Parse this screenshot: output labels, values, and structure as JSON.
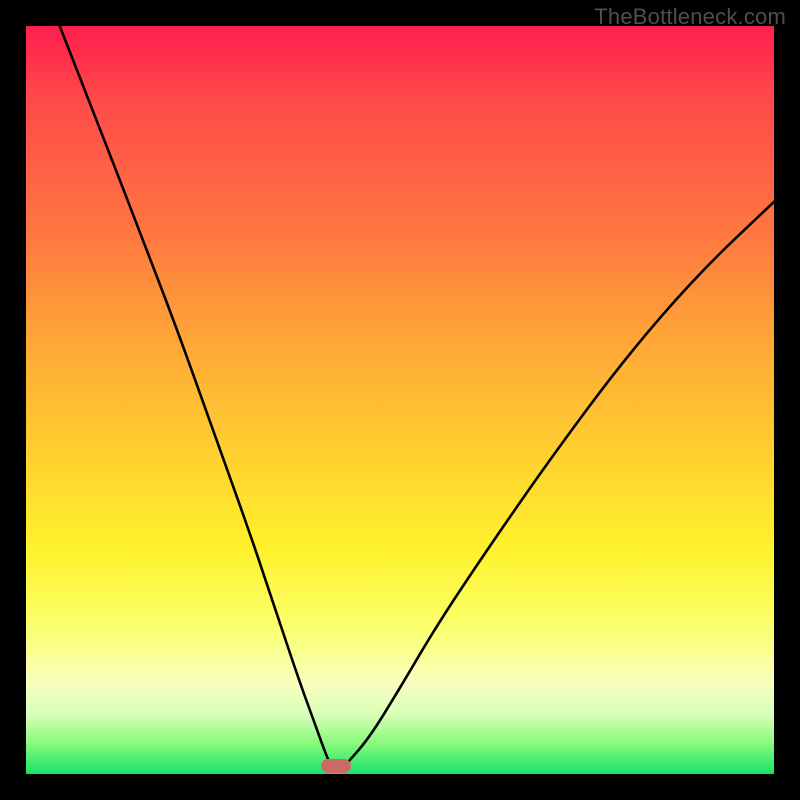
{
  "watermark_text": "TheBottleneck.com",
  "chart_data": {
    "type": "line",
    "title": "",
    "xlabel": "",
    "ylabel": "",
    "x_range_norm": [
      0,
      1
    ],
    "y_range_norm": [
      0,
      1
    ],
    "note": "Axes are unlabeled; values are normalized 0–1 where (0,0) is bottom-left of the colored plot area. Curve is a V-shaped profile with minimum near x≈0.41.",
    "series": [
      {
        "name": "bottleneck-curve",
        "x": [
          0.045,
          0.1,
          0.15,
          0.2,
          0.25,
          0.3,
          0.33,
          0.36,
          0.385,
          0.405,
          0.415,
          0.43,
          0.46,
          0.5,
          0.55,
          0.62,
          0.7,
          0.8,
          0.9,
          1.0
        ],
        "y": [
          1.0,
          0.86,
          0.73,
          0.6,
          0.46,
          0.32,
          0.23,
          0.14,
          0.07,
          0.015,
          0.0,
          0.015,
          0.05,
          0.115,
          0.2,
          0.305,
          0.42,
          0.555,
          0.67,
          0.765
        ]
      }
    ],
    "gradient_stops": [
      {
        "pos": 0.0,
        "color": "#ff1e4e"
      },
      {
        "pos": 0.28,
        "color": "#ff7840"
      },
      {
        "pos": 0.58,
        "color": "#ffd22f"
      },
      {
        "pos": 0.8,
        "color": "#fbff6a"
      },
      {
        "pos": 0.96,
        "color": "#86f97a"
      },
      {
        "pos": 1.0,
        "color": "#18e36a"
      }
    ],
    "marker": {
      "name": "optimum-marker",
      "x_norm": 0.415,
      "y_norm": 0.005,
      "color": "#cc6b66"
    }
  }
}
